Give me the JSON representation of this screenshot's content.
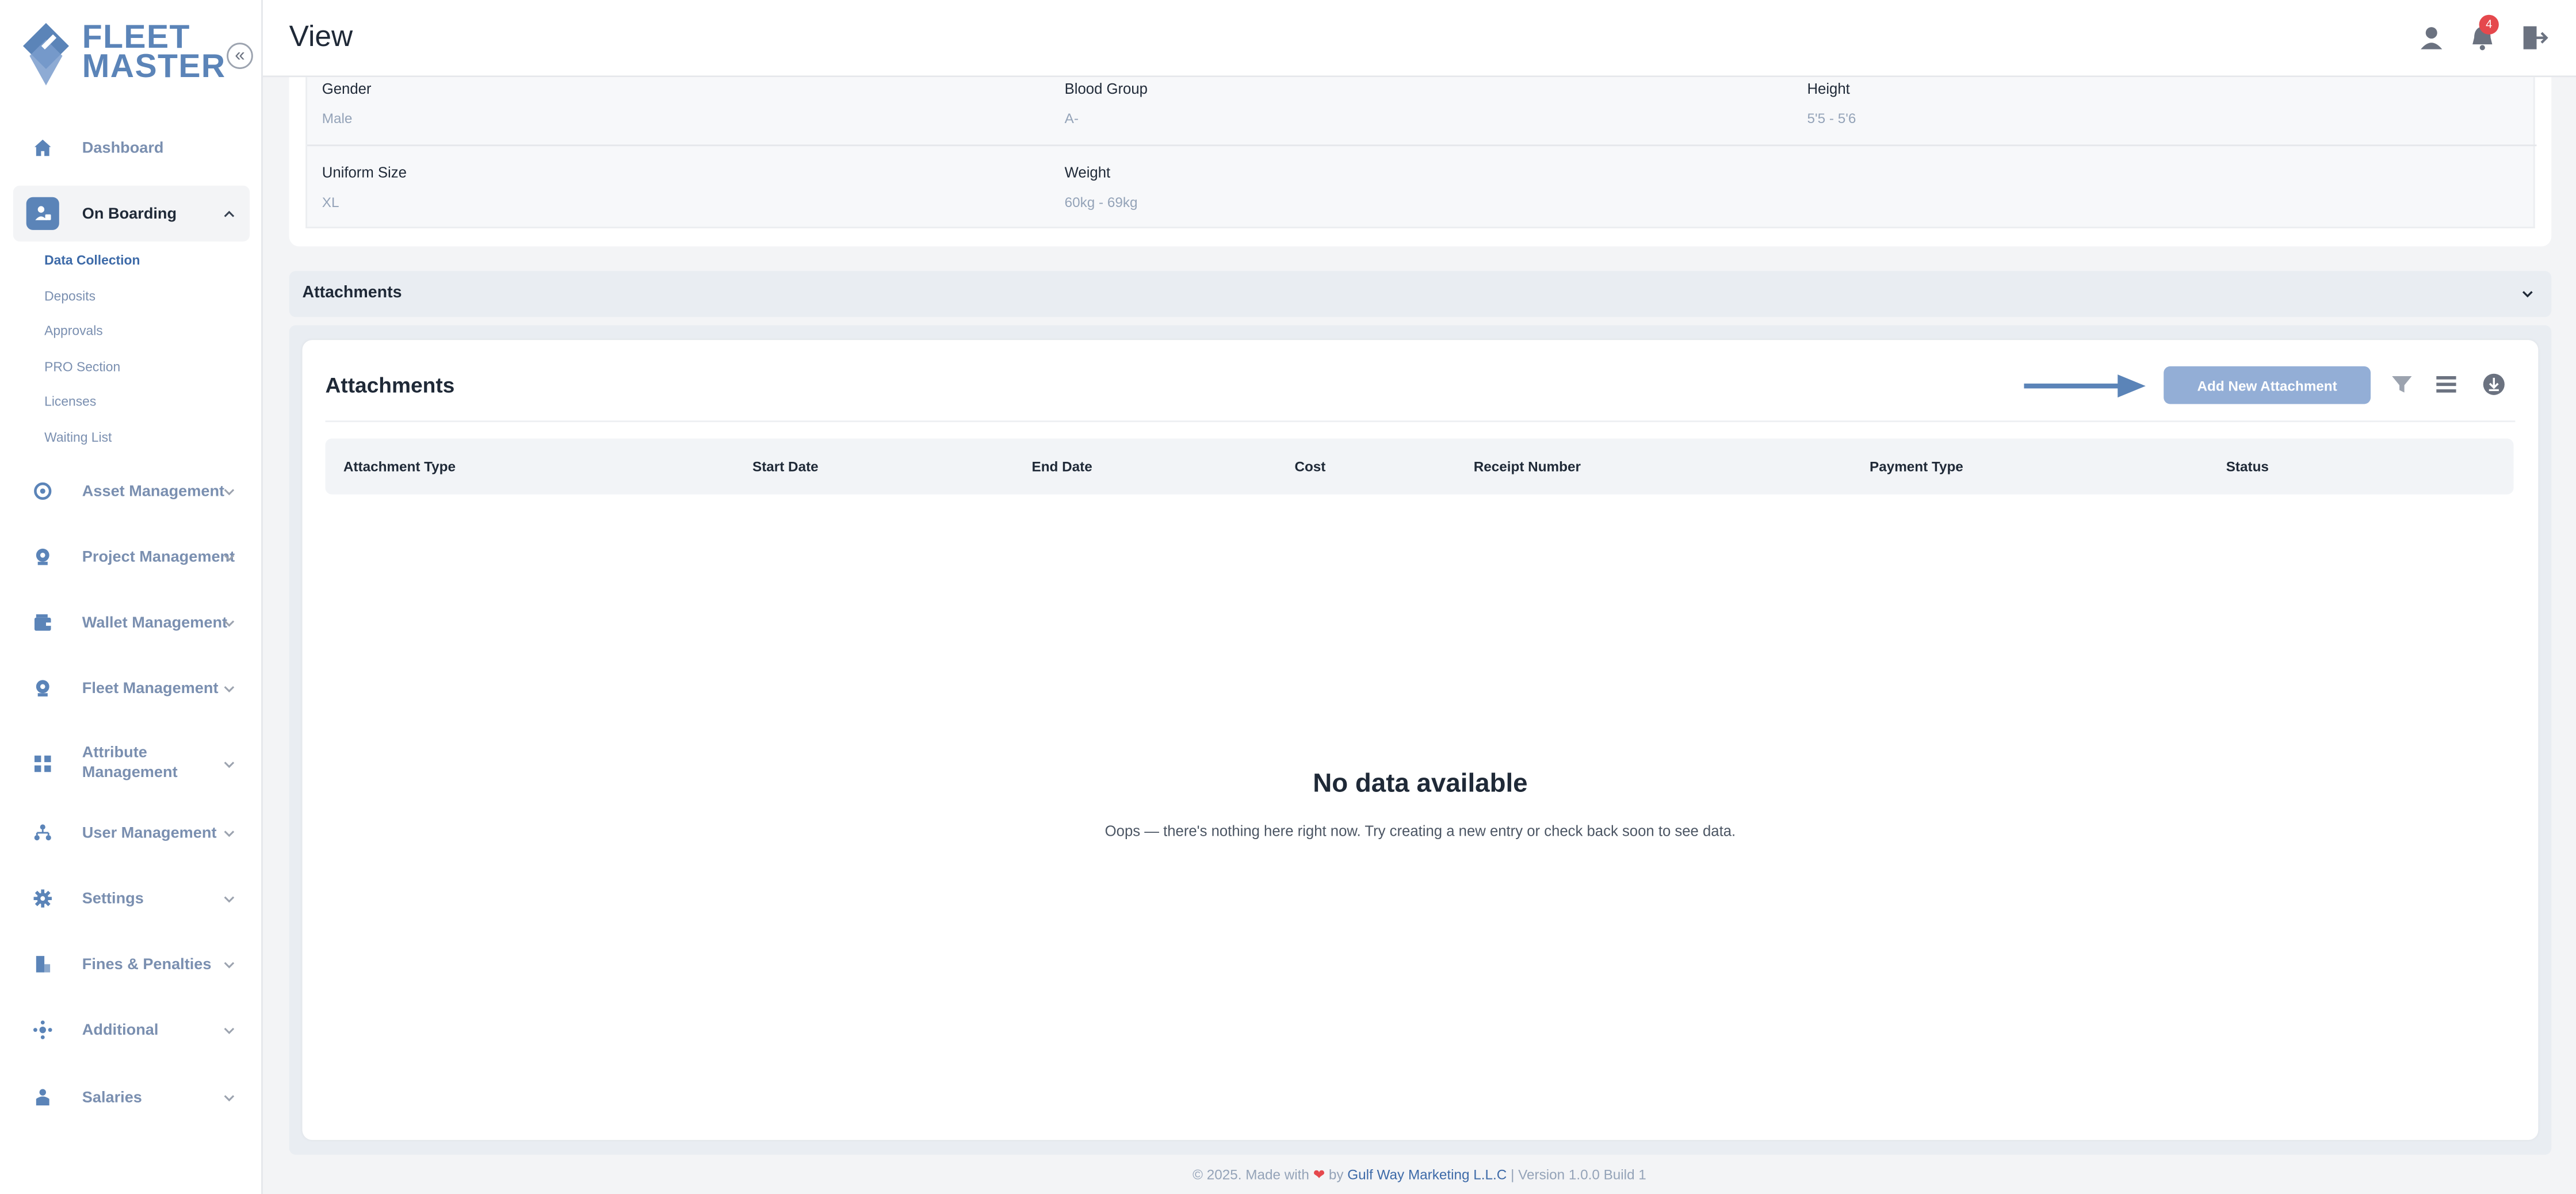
{
  "brand": {
    "line1": "FLEET",
    "line2": "MASTER"
  },
  "sidebar": {
    "collapse_glyph": "«",
    "items": [
      {
        "label": "Dashboard",
        "icon": "home-icon"
      },
      {
        "label": "On Boarding",
        "icon": "onboarding-icon",
        "expanded": true
      },
      {
        "label": "Asset Management",
        "icon": "asset-icon"
      },
      {
        "label": "Project Management",
        "icon": "project-icon"
      },
      {
        "label": "Wallet Management",
        "icon": "wallet-icon"
      },
      {
        "label": "Fleet Management",
        "icon": "fleet-icon"
      },
      {
        "label": "Attribute",
        "label2": "Management",
        "icon": "attribute-icon"
      },
      {
        "label": "User Management",
        "icon": "users-icon"
      },
      {
        "label": "Settings",
        "icon": "gear-icon"
      },
      {
        "label": "Fines & Penalties",
        "icon": "fines-icon"
      },
      {
        "label": "Additional",
        "icon": "additional-icon"
      },
      {
        "label": "Salaries",
        "icon": "salaries-icon"
      }
    ],
    "onboarding_sub": [
      "Data Collection",
      "Deposits",
      "Approvals",
      "PRO Section",
      "Licenses",
      "Waiting List"
    ]
  },
  "header": {
    "title": "View",
    "notification_count": "4"
  },
  "info": {
    "gender_label": "Gender",
    "gender_value": "Male",
    "blood_label": "Blood Group",
    "blood_value": "A-",
    "height_label": "Height",
    "height_value": "5'5 - 5'6",
    "uniform_label": "Uniform Size",
    "uniform_value": "XL",
    "weight_label": "Weight",
    "weight_value": "60kg - 69kg"
  },
  "accordion": {
    "title": "Attachments"
  },
  "attachments": {
    "heading": "Attachments",
    "add_button": "Add New Attachment",
    "columns": [
      "Attachment Type",
      "Start Date",
      "End Date",
      "Cost",
      "Receipt Number",
      "Payment Type",
      "Status"
    ],
    "empty_title": "No data available",
    "empty_message": "Oops — there's nothing here right now. Try creating a new entry or check back soon to see data."
  },
  "footer": {
    "prefix": "© 2025. Made with",
    "by": "by",
    "company": "Gulf Way Marketing L.L.C",
    "version": "| Version 1.0.0 Build 1"
  },
  "colors": {
    "accent": "#5b84b8",
    "button": "#93aed6",
    "badge": "#e5484d"
  }
}
